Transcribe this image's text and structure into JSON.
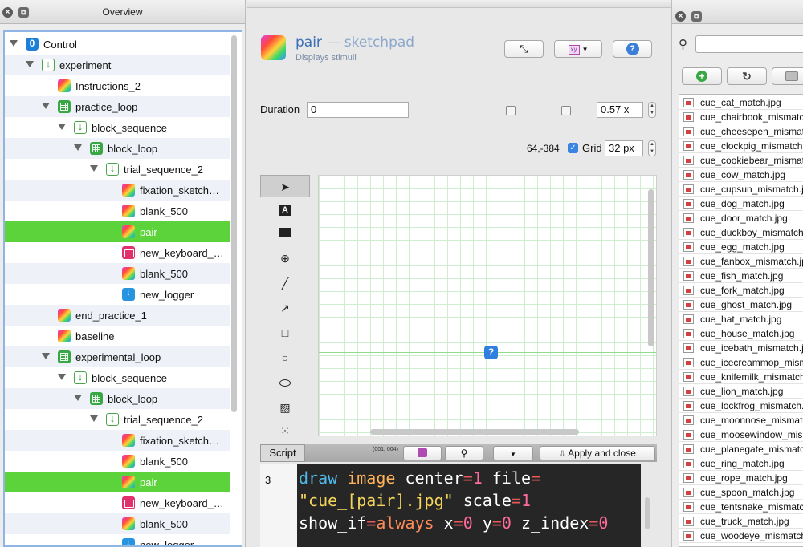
{
  "overview": {
    "title": "Overview",
    "tree": [
      {
        "label": "Control",
        "type": "ctrl",
        "depth": 0,
        "arrow": true
      },
      {
        "label": "experiment",
        "type": "seq",
        "depth": 1,
        "arrow": true
      },
      {
        "label": "Instructions_2",
        "type": "sketch",
        "depth": 2,
        "arrow": false
      },
      {
        "label": "practice_loop",
        "type": "loop",
        "depth": 2,
        "arrow": true
      },
      {
        "label": "block_sequence",
        "type": "seq",
        "depth": 3,
        "arrow": true
      },
      {
        "label": "block_loop",
        "type": "loop",
        "depth": 4,
        "arrow": true
      },
      {
        "label": "trial_sequence_2",
        "type": "seq",
        "depth": 5,
        "arrow": true
      },
      {
        "label": "fixation_sketch…",
        "type": "sketch",
        "depth": 6,
        "arrow": false
      },
      {
        "label": "blank_500",
        "type": "sketch",
        "depth": 6,
        "arrow": false
      },
      {
        "label": "pair",
        "type": "sketch",
        "depth": 6,
        "arrow": false,
        "selected": true
      },
      {
        "label": "new_keyboard_…",
        "type": "kbd",
        "depth": 6,
        "arrow": false
      },
      {
        "label": "blank_500",
        "type": "sketch",
        "depth": 6,
        "arrow": false
      },
      {
        "label": "new_logger",
        "type": "logger",
        "depth": 6,
        "arrow": false
      },
      {
        "label": "end_practice_1",
        "type": "sketch",
        "depth": 2,
        "arrow": false
      },
      {
        "label": "baseline",
        "type": "sketch",
        "depth": 2,
        "arrow": false
      },
      {
        "label": "experimental_loop",
        "type": "loop",
        "depth": 2,
        "arrow": true
      },
      {
        "label": "block_sequence",
        "type": "seq",
        "depth": 3,
        "arrow": true
      },
      {
        "label": "block_loop",
        "type": "loop",
        "depth": 4,
        "arrow": true
      },
      {
        "label": "trial_sequence_2",
        "type": "seq",
        "depth": 5,
        "arrow": true
      },
      {
        "label": "fixation_sketch…",
        "type": "sketch",
        "depth": 6,
        "arrow": false
      },
      {
        "label": "blank_500",
        "type": "sketch",
        "depth": 6,
        "arrow": false
      },
      {
        "label": "pair",
        "type": "sketch",
        "depth": 6,
        "arrow": false,
        "selected": true
      },
      {
        "label": "new_keyboard_…",
        "type": "kbd",
        "depth": 6,
        "arrow": false
      },
      {
        "label": "blank_500",
        "type": "sketch",
        "depth": 6,
        "arrow": false
      },
      {
        "label": "new_logger",
        "type": "logger",
        "depth": 6,
        "arrow": false
      }
    ]
  },
  "item": {
    "name": "pair",
    "separator": "—",
    "type": "sketchpad",
    "description": "Displays stimuli",
    "help_label": "?",
    "xy_label": "xy"
  },
  "settings": {
    "duration_label": "Duration",
    "duration_value": "0",
    "zoom_value": "0.57 x",
    "coords": "64,-384",
    "grid_label": "Grid",
    "grid_value": "32 px",
    "grid_checked": true
  },
  "toolbox": [
    "pointer-icon",
    "text-icon",
    "image-icon",
    "fixdot-icon",
    "line-icon",
    "arrow-icon",
    "rect-icon",
    "circle-icon",
    "ellipse-icon",
    "gabor-icon",
    "noise-icon"
  ],
  "canvas": {
    "element_glyph": "?"
  },
  "script": {
    "tab_label": "Script",
    "coord_readout": "(001, 004)",
    "apply_label": "Apply and close",
    "line_number": "3",
    "code": {
      "cmd": "draw",
      "elem": "image",
      "k_center": "center",
      "v_center": "1",
      "k_file": "file",
      "v_file": "\"cue_[pair].jpg\"",
      "k_scale": "scale",
      "v_scale": "1",
      "k_show": "show_if",
      "v_show": "always",
      "k_x": "x",
      "v_x": "0",
      "k_y": "y",
      "v_y": "0",
      "k_z": "z_index",
      "v_z": "0"
    }
  },
  "filepool": {
    "search_placeholder": "",
    "files": [
      "cue_cat_match.jpg",
      "cue_chairbook_mismatch",
      "cue_cheesepen_mismatch",
      "cue_clockpig_mismatch.",
      "cue_cookiebear_mismatch",
      "cue_cow_match.jpg",
      "cue_cupsun_mismatch.jp",
      "cue_dog_match.jpg",
      "cue_door_match.jpg",
      "cue_duckboy_mismatch",
      "cue_egg_match.jpg",
      "cue_fanbox_mismatch.jp",
      "cue_fish_match.jpg",
      "cue_fork_match.jpg",
      "cue_ghost_match.jpg",
      "cue_hat_match.jpg",
      "cue_house_match.jpg",
      "cue_icebath_mismatch.j",
      "cue_icecreammop_mism",
      "cue_knifemilk_mismatch",
      "cue_lion_match.jpg",
      "cue_lockfrog_mismatch.",
      "cue_moonnose_mismatc",
      "cue_moosewindow_mism",
      "cue_planegate_mismatc",
      "cue_ring_match.jpg",
      "cue_rope_match.jpg",
      "cue_spoon_match.jpg",
      "cue_tentsnake_mismatc",
      "cue_truck_match.jpg",
      "cue_woodeye_mismatch"
    ]
  },
  "colors": {
    "selection": "#5dd33b",
    "accent_blue": "#3b7fd9",
    "grid_line": "#cfeecf"
  }
}
